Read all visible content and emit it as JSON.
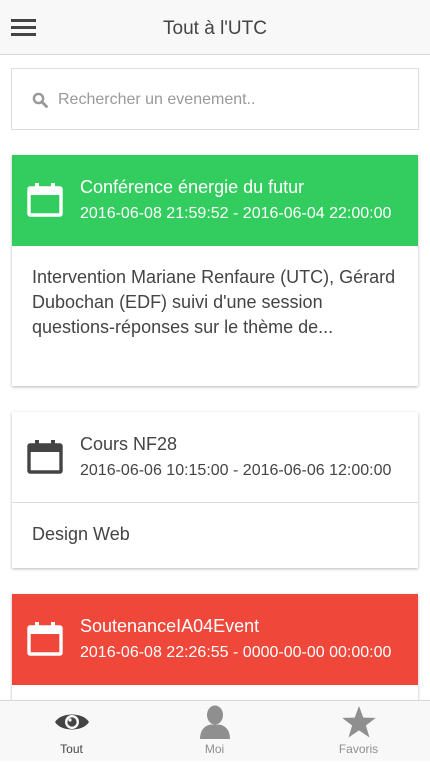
{
  "header": {
    "title": "Tout à l'UTC",
    "menu_icon": "hamburger-menu-icon"
  },
  "search": {
    "placeholder": "Rechercher un evenement..",
    "value": "",
    "icon": "search-icon"
  },
  "events": [
    {
      "title": "Conférence énergie du futur",
      "dates": "2016-06-08 21:59:52 - 2016-06-04 22:00:00",
      "description": "Intervention Mariane Renfaure (UTC), Gérard Dubochan (EDF) suivi d'une session questions-réponses sur le thème de...",
      "color": "#33cd5f",
      "icon": "calendar-icon"
    },
    {
      "title": "Cours NF28",
      "dates": "2016-06-06 10:15:00 - 2016-06-06 12:00:00",
      "description": "Design Web",
      "color": "#ffffff",
      "icon": "calendar-icon"
    },
    {
      "title": "SoutenanceIA04Event",
      "dates": "2016-06-08 22:26:55 - 0000-00-00 00:00:00",
      "description": "",
      "color": "#ef473a",
      "icon": "calendar-icon"
    }
  ],
  "tabs": [
    {
      "label": "Tout",
      "icon": "eye-icon",
      "active": true,
      "color": "#444444"
    },
    {
      "label": "Moi",
      "icon": "person-icon",
      "active": false,
      "color": "#8f8f8f"
    },
    {
      "label": "Favoris",
      "icon": "star-icon",
      "active": false,
      "color": "#8f8f8f"
    }
  ]
}
